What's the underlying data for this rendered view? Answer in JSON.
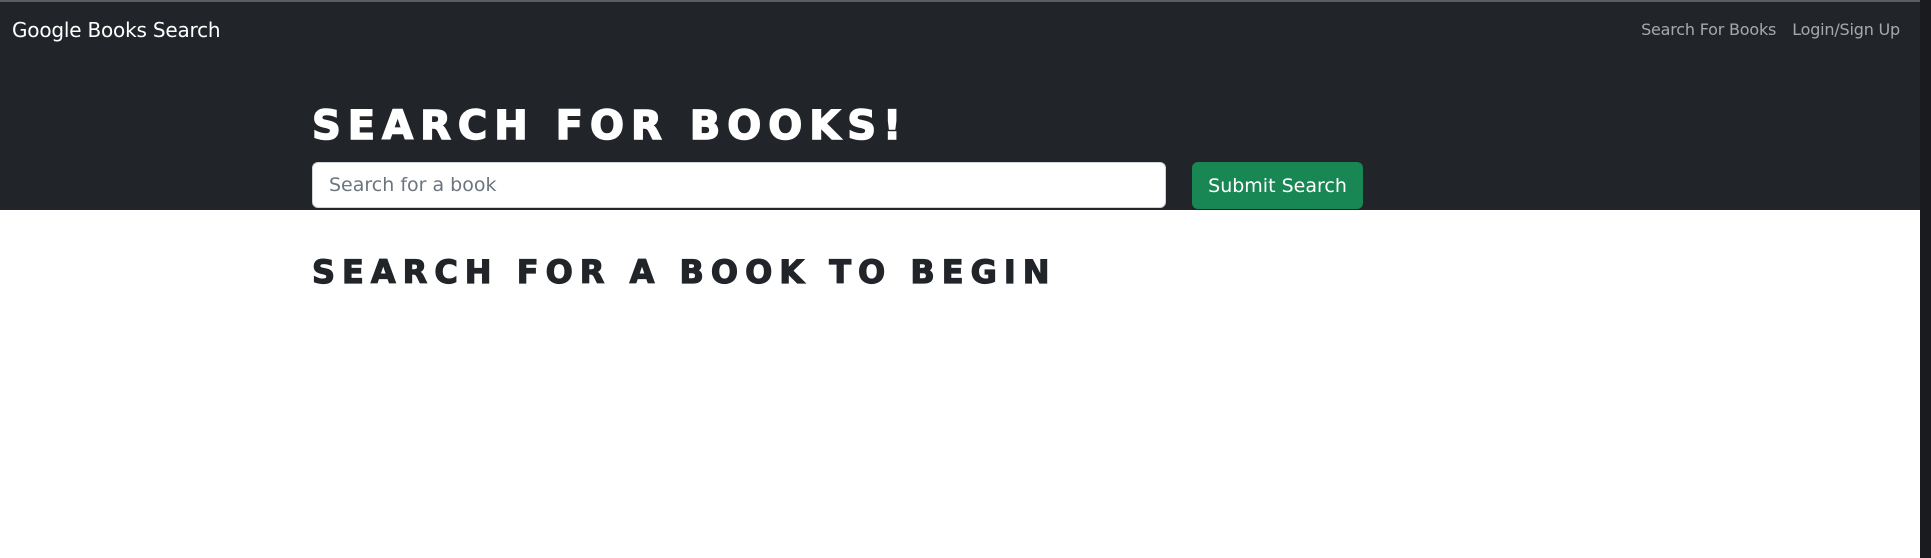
{
  "navbar": {
    "brand": "Google Books Search",
    "links": [
      {
        "label": "Search For Books"
      },
      {
        "label": "Login/Sign Up"
      }
    ]
  },
  "hero": {
    "title": "Search for Books!",
    "search": {
      "placeholder": "Search for a book",
      "value": ""
    },
    "submit_label": "Submit Search"
  },
  "results": {
    "heading": "Search for a book to begin"
  },
  "colors": {
    "dark_bg": "#212529",
    "button_green": "#198754",
    "page_bg": "#ffffff"
  }
}
